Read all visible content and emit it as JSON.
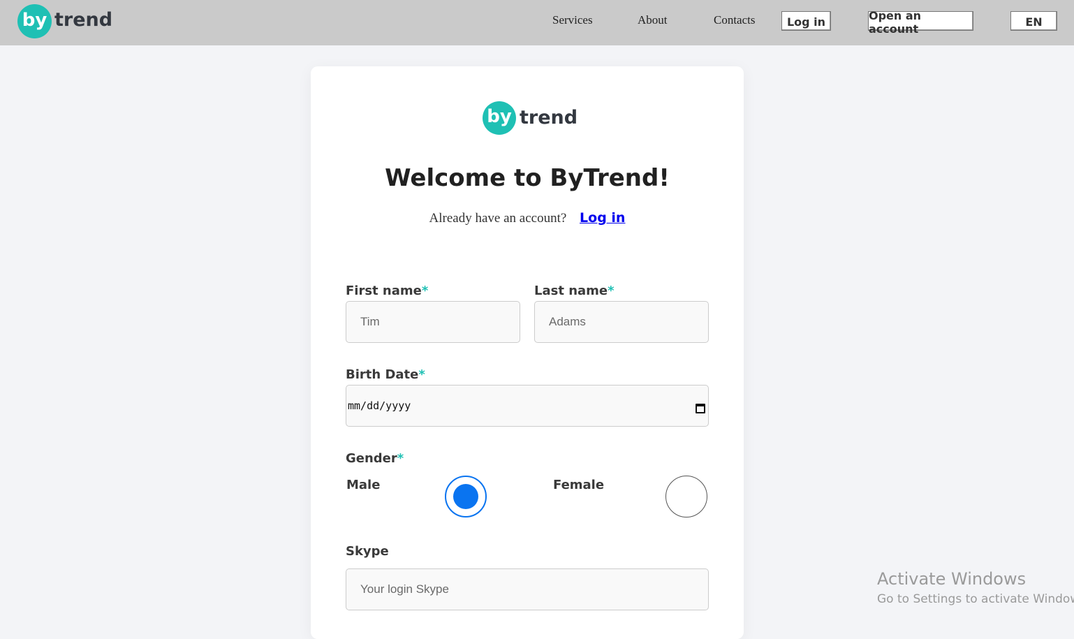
{
  "brand": {
    "logo_mark": "by",
    "logo_word": "trend",
    "accent_color": "#1fc0b4"
  },
  "nav": {
    "services": "Services",
    "about": "About",
    "contacts": "Contacts",
    "login": "Log in",
    "open_account": "Open an account",
    "language": "EN"
  },
  "card": {
    "title": "Welcome to ByTrend!",
    "already_text": "Already have an account?",
    "login_link": "Log in"
  },
  "form": {
    "required_mark": "*",
    "first_name": {
      "label": "First name",
      "placeholder": "Tim"
    },
    "last_name": {
      "label": "Last name",
      "placeholder": "Adams"
    },
    "birth_date": {
      "label": "Birth Date",
      "value_format": "mm/dd/yyyy",
      "icon": "calendar-icon"
    },
    "gender": {
      "label": "Gender",
      "options": [
        {
          "label": "Male",
          "selected": true
        },
        {
          "label": "Female",
          "selected": false
        }
      ],
      "selected_color": "#0a74f0"
    },
    "skype": {
      "label": "Skype",
      "placeholder": "Your login Skype"
    }
  },
  "watermark": {
    "title": "Activate Windows",
    "subtitle": "Go to Settings to activate Windows."
  }
}
